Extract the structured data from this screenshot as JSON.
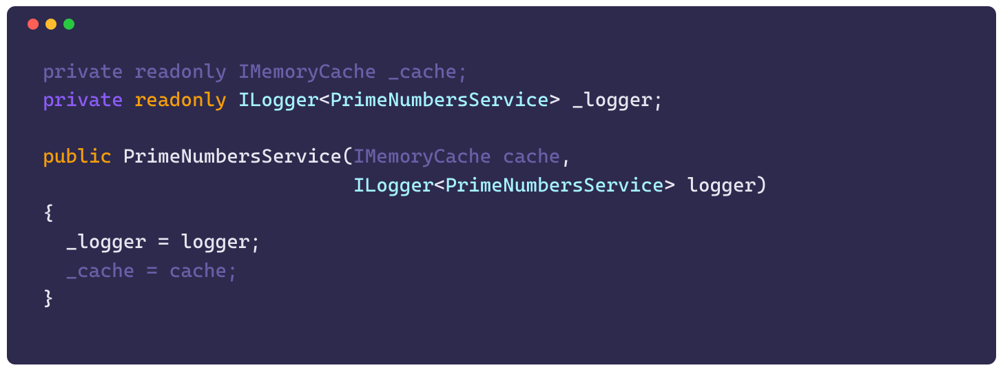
{
  "window": {
    "traffic_lights": [
      "red",
      "yellow",
      "green"
    ]
  },
  "code": {
    "line1": {
      "kw1": "private",
      "kw2": "readonly",
      "type": "IMemoryCache",
      "name": "_cache",
      "semi": ";"
    },
    "line2": {
      "kw1": "private",
      "kw2": "readonly",
      "type": "ILogger",
      "lt": "<",
      "generic": "PrimeNumbersService",
      "gt": ">",
      "name": "_logger",
      "semi": ";"
    },
    "line4": {
      "kw1": "public",
      "name": "PrimeNumbersService",
      "open": "(",
      "p1type": "IMemoryCache",
      "p1name": "cache",
      "comma": ","
    },
    "line5": {
      "indent": "                           ",
      "type": "ILogger",
      "lt": "<",
      "generic": "PrimeNumbersService",
      "gt": ">",
      "name": "logger",
      "close": ")"
    },
    "line6": {
      "brace": "{"
    },
    "line7": {
      "indent": "  ",
      "lhs": "_logger",
      "eq": " = ",
      "rhs": "logger",
      "semi": ";"
    },
    "line8": {
      "indent": "  ",
      "lhs": "_cache",
      "eq": " = ",
      "rhs": "cache",
      "semi": ";"
    },
    "line9": {
      "brace": "}"
    }
  }
}
